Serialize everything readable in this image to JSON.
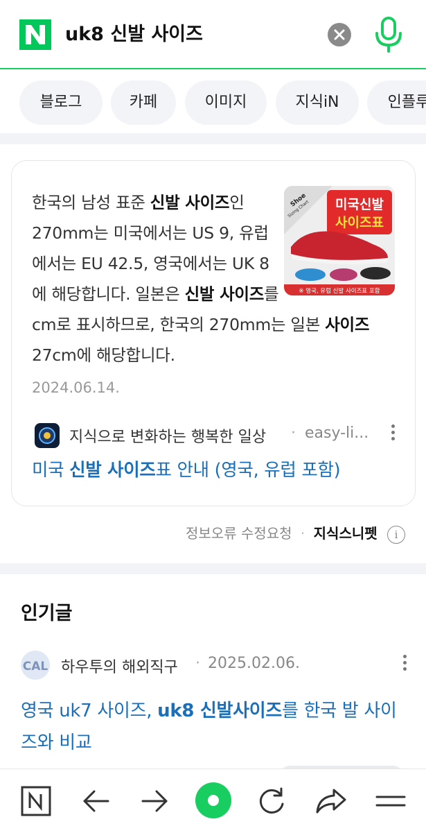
{
  "search": {
    "logo_letter": "N",
    "query": "uk8 신발 사이즈",
    "brand_color": "#03c75a"
  },
  "tabs": [
    "블로그",
    "카페",
    "이미지",
    "지식iN",
    "인플루"
  ],
  "snippet": {
    "text_parts": [
      {
        "t": "한국의 남성 표준 ",
        "b": false
      },
      {
        "t": "신발 사이즈",
        "b": true
      },
      {
        "t": "인 270mm는 미국에서는 US 9, 유럽에서는 EU 42.5, 영국에서는 UK 8에 해당합니다. 일본은 ",
        "b": false
      },
      {
        "t": "신발 사이즈",
        "b": true
      },
      {
        "t": "를 cm로 표시하므로, 한국의 270mm는 일본 ",
        "b": false
      },
      {
        "t": "사이즈",
        "b": true
      },
      {
        "t": " 27cm에 해당합니다.",
        "b": false
      }
    ],
    "thumb_title_1": "미국신발",
    "thumb_title_2": "사이즈표",
    "thumb_caption": "※ 영국, 유럽 신발 사이즈표 포함",
    "thumb_ribbon_1": "Shoe",
    "thumb_ribbon_2": "Sizing Chart",
    "date": "2024.06.14.",
    "source_name": "지식으로 변화하는 행복한 일상",
    "source_dot": "·",
    "source_url": "easy-li...",
    "title_parts": [
      {
        "t": "미국 ",
        "b": false
      },
      {
        "t": "신발 사이즈",
        "b": true
      },
      {
        "t": "표 안내 (영국, 유럽 포함)",
        "b": false
      }
    ],
    "report_label": "정보오류 수정요청",
    "report_dot": "·",
    "snippet_label": "지식스니펫",
    "info_glyph": "i"
  },
  "popular": {
    "section_title": "인기글",
    "author": "하우투의 해외직구",
    "dot": "·",
    "date": "2025.02.06.",
    "avatar_text": "CAL",
    "headline_parts": [
      {
        "t": "영국 uk7 사이즈, ",
        "b": false
      },
      {
        "t": "uk8 신발사이즈",
        "b": true
      },
      {
        "t": "를 한국 발 사이즈와 비교",
        "b": false
      }
    ]
  },
  "bottom_nav": [
    "naver-home-icon",
    "back-arrow-icon",
    "forward-arrow-icon",
    "green-dot-icon",
    "refresh-icon",
    "share-icon",
    "menu-icon"
  ],
  "colors": {
    "link": "#1a6fb8",
    "green": "#19ce60",
    "tab_bg": "#f2f4f7"
  }
}
